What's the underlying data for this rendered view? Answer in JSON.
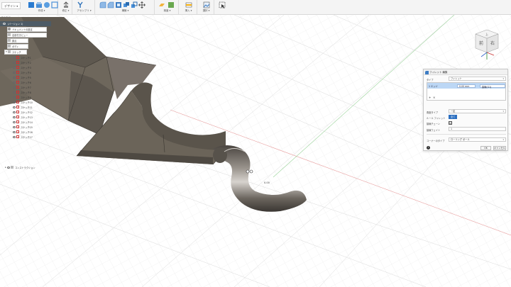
{
  "toolbar": {
    "workspace": "デザイン ▾",
    "groups": [
      {
        "label": "作成 ▾"
      },
      {
        "label": "修正 ▾"
      },
      {
        "label": "アセンブリ ▾"
      },
      {
        "label": "構築 ▾"
      },
      {
        "label": "検査 ▾"
      },
      {
        "label": "挿入 ▾"
      },
      {
        "label": "選択 ▾"
      }
    ]
  },
  "browser": {
    "title": "ブラウザ",
    "root": "（バージョン 1）",
    "items": [
      "ドキュメントの設定",
      "名前付きビュー",
      "原点",
      "ボディ",
      "スケッチ",
      "スケッチ1",
      "スケッチ2",
      "スケッチ3",
      "スケッチ4",
      "スケッチ5",
      "スケッチ6",
      "スケッチ7",
      "スケッチ8",
      "スケッチ9",
      "スケッチ10",
      "スケッチ11",
      "スケッチ12",
      "スケッチ13",
      "スケッチ14",
      "スケッチ15",
      "スケッチ16",
      "スケッチ17",
      "コンストラクション"
    ]
  },
  "viewcube": {
    "top": "上",
    "front": "前",
    "right": "右"
  },
  "dialog": {
    "title": "フィレット 編集",
    "type_label": "タイプ",
    "type_value": "フィレット",
    "selection_item": "1 エッジ",
    "radius_value": "0.00 mm",
    "continuity": "接線(G1)",
    "corner_type_label": "角度タイプ",
    "corner_type_value": "一定",
    "rule_label": "ルール フィレット",
    "rule_value": "全て",
    "tangent_chain_label": "接線チェーン",
    "tangent_chain_checked": "☑",
    "tangent_weight_label": "接線ウェイト",
    "tangent_weight_value": "1",
    "corner_label": "コーナーのタイプ",
    "corner_value": "ローリング ボール",
    "ok": "OK",
    "cancel": "キャンセル"
  },
  "colors": {
    "accent": "#0696d7",
    "model": "#6e6659",
    "selection": "#bcd7f5"
  }
}
